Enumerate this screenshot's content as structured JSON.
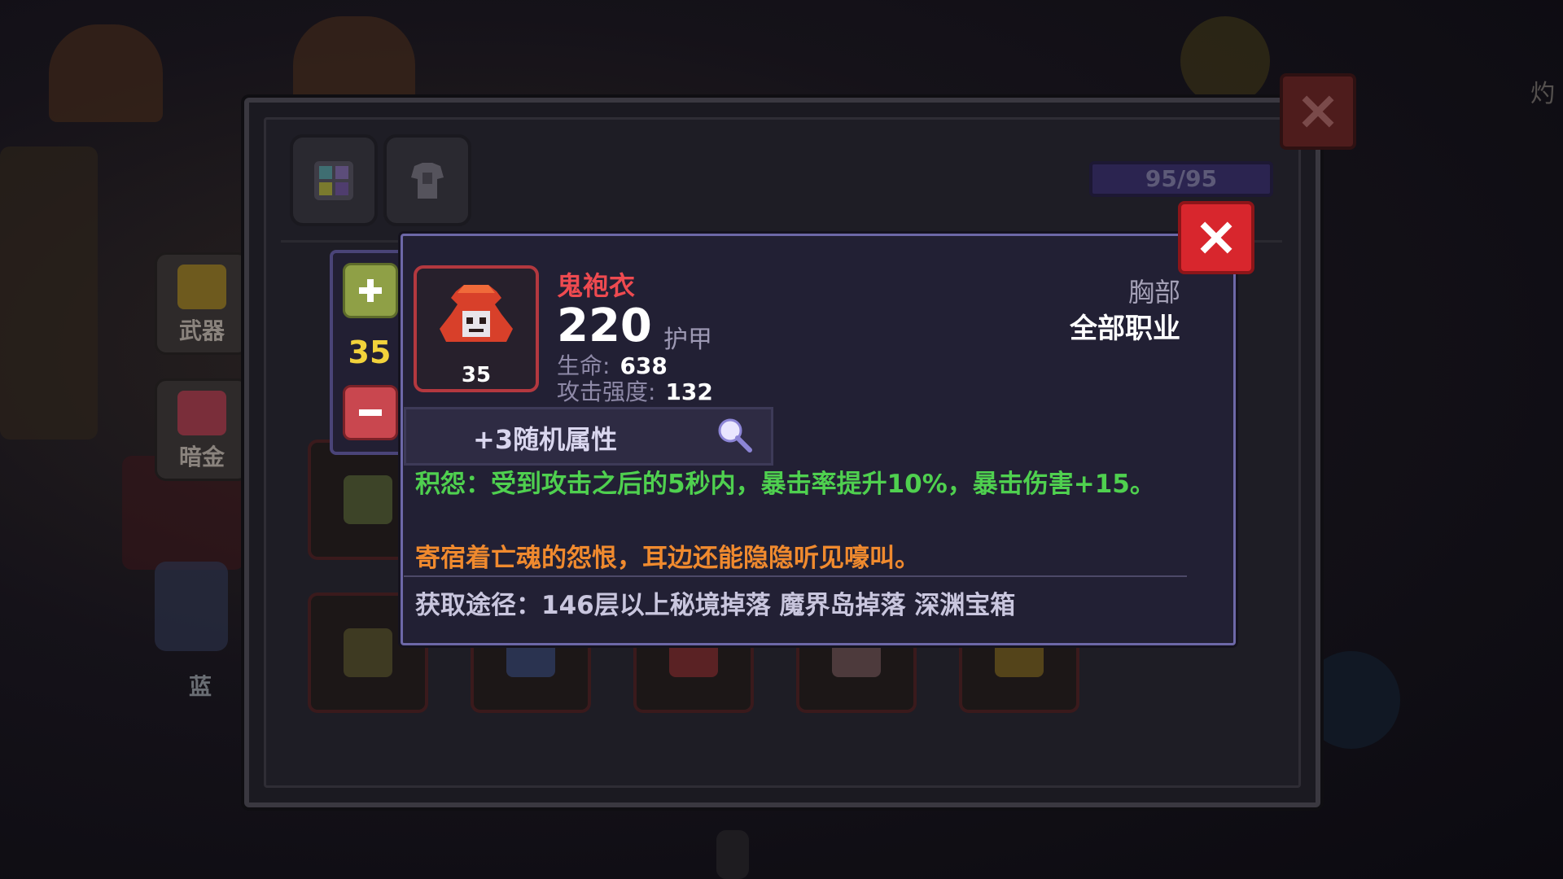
{
  "background": {
    "side_tabs": [
      {
        "label": "武器"
      },
      {
        "label": "暗金"
      }
    ],
    "partial_tab_label": "蓝",
    "right_edge_text": "灼"
  },
  "inventory": {
    "capacity": "95/95",
    "filters": [
      {
        "icon": "grid-icon"
      },
      {
        "icon": "armor-icon"
      }
    ]
  },
  "stepper": {
    "level": "35"
  },
  "tooltip": {
    "item_name": "鬼袍衣",
    "item_level": "35",
    "armor_value": "220",
    "armor_label": "护甲",
    "stats": [
      {
        "label": "生命:",
        "value": "638"
      },
      {
        "label": "攻击强度:",
        "value": "132"
      }
    ],
    "slot": "胸部",
    "class_requirement": "全部职业",
    "random_attributes": "+3随机属性",
    "effect": "积怨：受到攻击之后的5秒内，暴击率提升10%，暴击伤害+15。",
    "lore": "寄宿着亡魂的怨恨，耳边还能隐隐听见嚎叫。",
    "source": "获取途径：146层以上秘境掉落 魔界岛掉落 深渊宝箱"
  },
  "colors": {
    "item_name": "#ee4a50",
    "effect": "#4fd04f",
    "lore": "#f08a2e",
    "level": "#f2d23b",
    "close": "#d8262d"
  }
}
